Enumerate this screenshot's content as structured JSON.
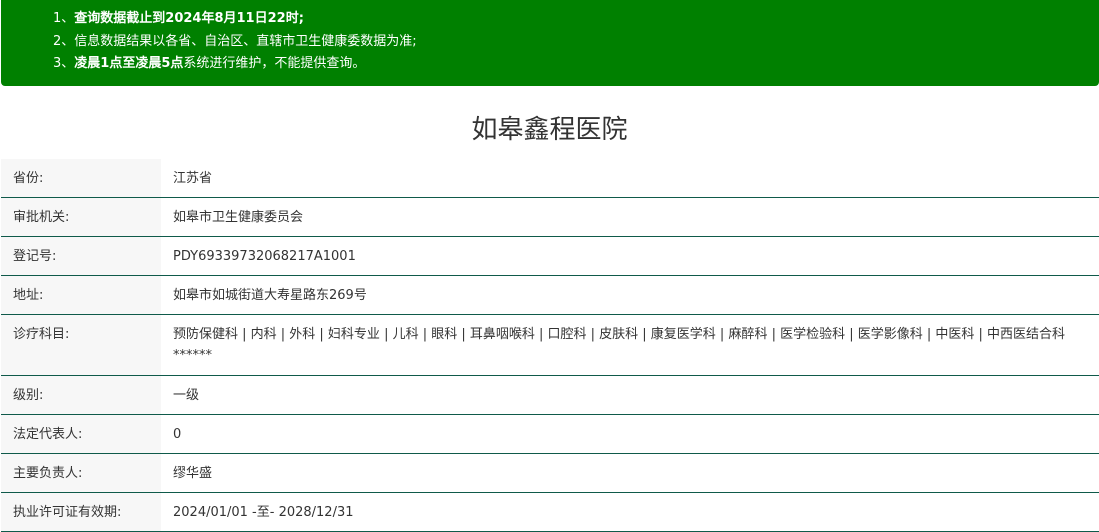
{
  "notice": {
    "line1_prefix": "1、",
    "line1_text": "查询数据截止到2024年8月11日22时;",
    "line2_prefix": "2、",
    "line2_text": "信息数据结果以各省、自治区、直辖市卫生健康委数据为准;",
    "line3_prefix": "3、",
    "line3_bold": "凌晨1点至凌晨5点",
    "line3_text": "系统进行维护，不能提供查询。"
  },
  "title": "如皋鑫程医院",
  "rows": [
    {
      "label": "省份:",
      "value": "江苏省"
    },
    {
      "label": "审批机关:",
      "value": "如皋市卫生健康委员会"
    },
    {
      "label": "登记号:",
      "value": "PDY69339732068217A1001"
    },
    {
      "label": "地址:",
      "value": "如皋市如城街道大寿星路东269号"
    },
    {
      "label": "诊疗科目:",
      "value": "预防保健科 | 内科 | 外科 | 妇科专业 | 儿科 | 眼科 | 耳鼻咽喉科 | 口腔科 | 皮肤科 | 康复医学科 | 麻醉科 | 医学检验科 | 医学影像科 | 中医科 | 中西医结合科******"
    },
    {
      "label": "级别:",
      "value": "一级"
    },
    {
      "label": "法定代表人:",
      "value": "0"
    },
    {
      "label": "主要负责人:",
      "value": "缪华盛"
    },
    {
      "label": "执业许可证有效期:",
      "value": "2024/01/01 -至- 2028/12/31"
    }
  ],
  "colors": {
    "notice_bg": "#008000",
    "row_border": "#0f5a4a",
    "label_bg": "#f7f7f7"
  }
}
